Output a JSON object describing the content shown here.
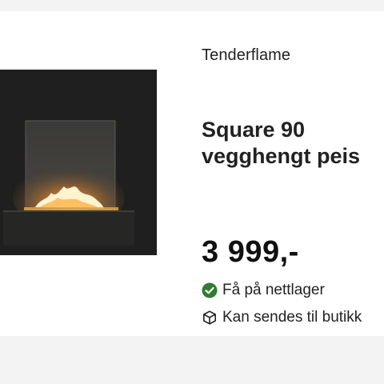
{
  "product": {
    "brand": "Tenderflame",
    "title": "Square 90 vegghengt peis",
    "price": "3 999,-",
    "image_icon": "fireplace-photo"
  },
  "availability": {
    "online": {
      "label": "Få på nettlager",
      "icon": "check-circle-icon",
      "color": "#2e7d32"
    },
    "store": {
      "label": "Kan sendes til butikk",
      "icon": "box-icon"
    }
  },
  "colors": {
    "page_background": "#f3f3f3",
    "card_background": "#ffffff",
    "text": "#222222",
    "available_green": "#2e7d32"
  }
}
